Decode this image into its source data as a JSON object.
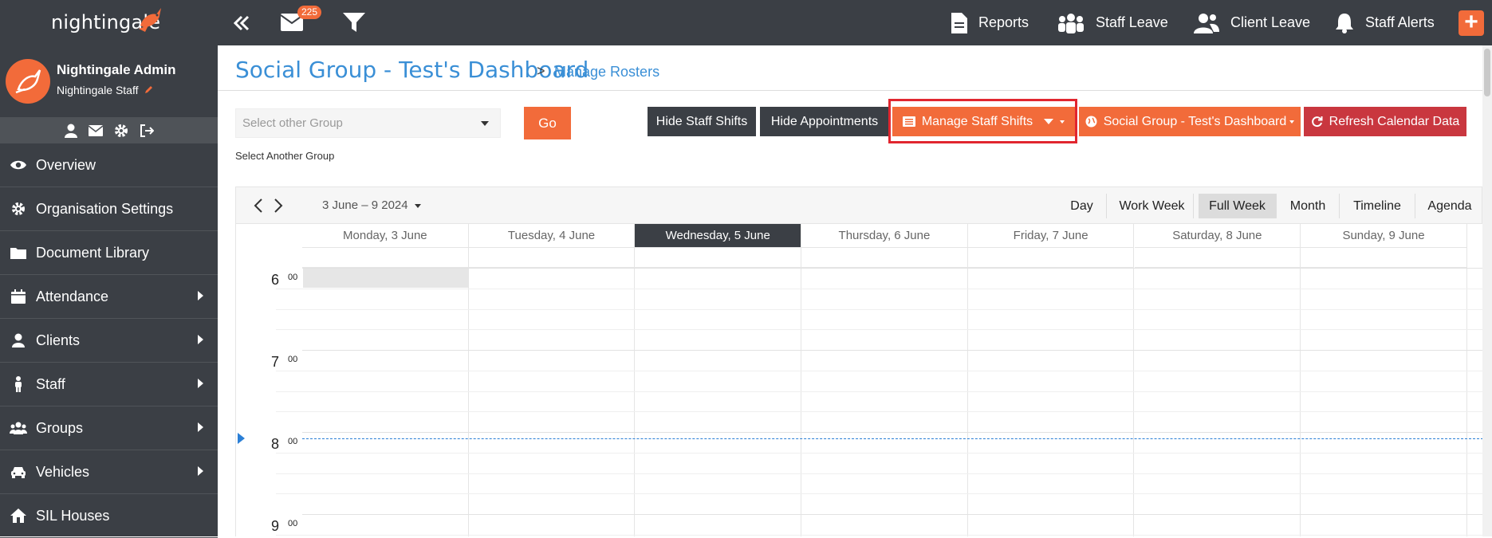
{
  "topbar": {
    "logo_text": "nightingale",
    "mail_count": "225",
    "nav": [
      {
        "label": "Reports",
        "icon": "file-icon"
      },
      {
        "label": "Staff Leave",
        "icon": "staff-group-icon"
      },
      {
        "label": "Client Leave",
        "icon": "users-icon"
      },
      {
        "label": "Staff Alerts",
        "icon": "bell-icon"
      }
    ],
    "plus_label": "+"
  },
  "sidebar": {
    "user_name": "Nightingale Admin",
    "user_role": "Nightingale Staff",
    "items": [
      {
        "label": "Overview",
        "icon": "eye-icon"
      },
      {
        "label": "Organisation Settings",
        "icon": "gear-icon"
      },
      {
        "label": "Document Library",
        "icon": "folder-icon"
      },
      {
        "label": "Attendance",
        "icon": "calendar-icon"
      },
      {
        "label": "Clients",
        "icon": "user-icon"
      },
      {
        "label": "Staff",
        "icon": "person-icon"
      },
      {
        "label": "Groups",
        "icon": "group-icon"
      },
      {
        "label": "Vehicles",
        "icon": "car-icon"
      },
      {
        "label": "SIL Houses",
        "icon": "house-icon"
      }
    ]
  },
  "header": {
    "title": "Social Group - Test's Dashboard",
    "breadcrumb_sep": ">",
    "breadcrumb": "Manage Rosters"
  },
  "controls": {
    "select_placeholder": "Select other Group",
    "go_label": "Go",
    "helper_text": "Select Another Group",
    "hide_staff_shifts": "Hide Staff Shifts",
    "hide_appointments": "Hide Appointments",
    "manage_staff_shifts": "Manage Staff Shifts",
    "dashboard_dropdown": "Social Group - Test's Dashboard",
    "refresh": "Refresh Calendar Data"
  },
  "calendar": {
    "range": "3 June – 9 2024",
    "views": [
      "Day",
      "Work Week",
      "Full Week",
      "Month",
      "Timeline",
      "Agenda"
    ],
    "active_view": "Full Week",
    "days": [
      "Monday, 3 June",
      "Tuesday, 4 June",
      "Wednesday, 5 June",
      "Thursday, 6 June",
      "Friday, 7 June",
      "Saturday, 8 June",
      "Sunday, 9 June"
    ],
    "today_index": 2,
    "hours": [
      "6",
      "7",
      "8",
      "9"
    ],
    "minutes": "00"
  },
  "colors": {
    "accent": "#f26b3a",
    "dark": "#3b3f45",
    "link": "#3a8fd6",
    "danger": "#c9373f"
  }
}
